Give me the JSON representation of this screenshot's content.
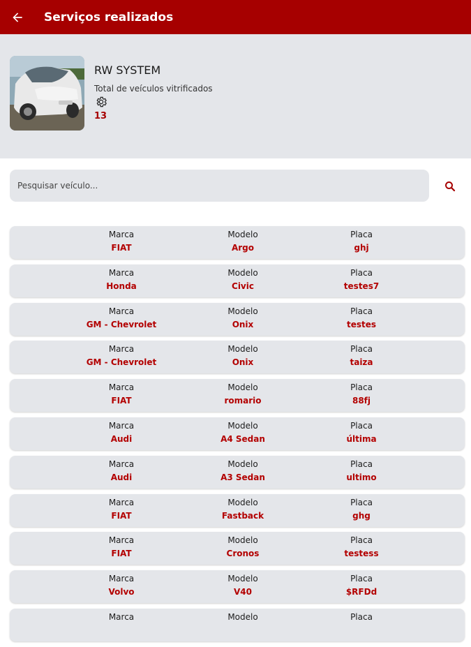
{
  "appbar": {
    "title": "Serviços realizados",
    "back_icon": "arrow-left-icon"
  },
  "profile": {
    "company": "RW SYSTEM",
    "vitrified_label": "Total de veículos vitrificados",
    "vitrified_count": "13"
  },
  "search": {
    "placeholder": "Pesquisar veículo..."
  },
  "table": {
    "headers": {
      "brand": "Marca",
      "model": "Modelo",
      "plate": "Placa"
    },
    "rows": [
      {
        "brand": "FIAT",
        "model": "Argo",
        "plate": "ghj"
      },
      {
        "brand": "Honda",
        "model": "Civic",
        "plate": "testes7"
      },
      {
        "brand": "GM - Chevrolet",
        "model": "Onix",
        "plate": "testes"
      },
      {
        "brand": "GM - Chevrolet",
        "model": "Onix",
        "plate": "taiza"
      },
      {
        "brand": "FIAT",
        "model": "romario",
        "plate": "88fj"
      },
      {
        "brand": "Audi",
        "model": "A4 Sedan",
        "plate": "última"
      },
      {
        "brand": "Audi",
        "model": "A3 Sedan",
        "plate": "ultimo"
      },
      {
        "brand": "FIAT",
        "model": "Fastback",
        "plate": "ghg"
      },
      {
        "brand": "FIAT",
        "model": "Cronos",
        "plate": "testess"
      },
      {
        "brand": "Volvo",
        "model": "V40",
        "plate": "$RFDd"
      },
      {
        "brand": "",
        "model": "",
        "plate": ""
      }
    ]
  },
  "colors": {
    "primary": "#a60000",
    "panel": "#e4e6ea",
    "value_text": "#b30000"
  }
}
